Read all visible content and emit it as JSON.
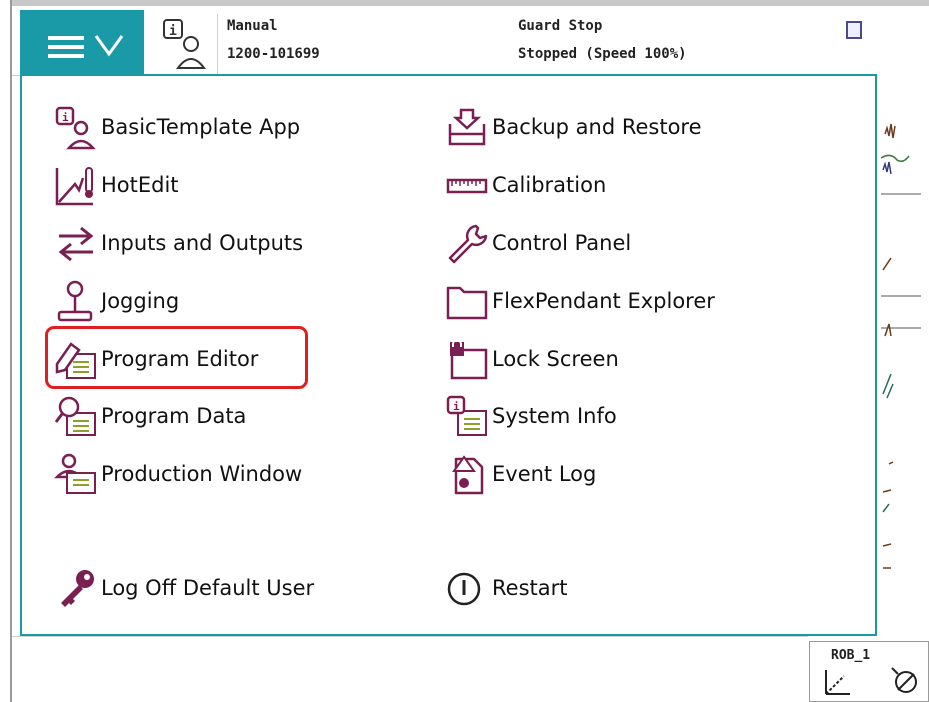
{
  "status": {
    "mode": "Manual",
    "system_id": "1200-101699",
    "guard_state": "Guard Stop",
    "run_state": "Stopped (Speed 100%)"
  },
  "menu": {
    "left_items": [
      {
        "label": "BasicTemplate App",
        "icon": "info-person-icon"
      },
      {
        "label": "HotEdit",
        "icon": "hotedit-icon"
      },
      {
        "label": "Inputs and Outputs",
        "icon": "arrows-exchange-icon"
      },
      {
        "label": "Jogging",
        "icon": "joystick-icon"
      },
      {
        "label": "Program Editor",
        "icon": "program-editor-icon"
      },
      {
        "label": "Program Data",
        "icon": "program-data-icon"
      },
      {
        "label": "Production Window",
        "icon": "production-window-icon"
      }
    ],
    "right_items": [
      {
        "label": "Backup and Restore",
        "icon": "backup-restore-icon"
      },
      {
        "label": "Calibration",
        "icon": "ruler-icon"
      },
      {
        "label": "Control Panel",
        "icon": "wrench-icon"
      },
      {
        "label": "FlexPendant Explorer",
        "icon": "folder-icon"
      },
      {
        "label": "Lock Screen",
        "icon": "lock-icon"
      },
      {
        "label": "System Info",
        "icon": "system-info-icon"
      },
      {
        "label": "Event Log",
        "icon": "event-log-icon"
      }
    ],
    "log_off_label": "Log Off Default User",
    "restart_label": "Restart",
    "highlighted_item": "Program Editor"
  },
  "quickset": {
    "robot_label": "ROB_1"
  },
  "colors": {
    "accent": "#1a9aa6",
    "icon_color": "#7a1f52",
    "highlight": "#e02020"
  }
}
